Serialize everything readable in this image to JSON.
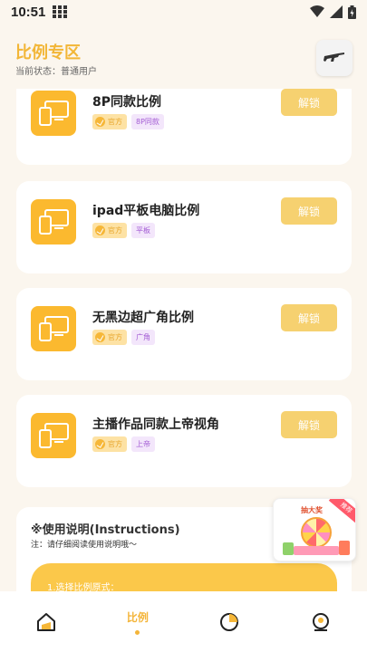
{
  "status_bar": {
    "time": "10:51"
  },
  "header": {
    "title": "比例专区",
    "status_text": "当前状态：普通用户"
  },
  "cards": [
    {
      "title": "8P同款比例",
      "official_tag": "官方",
      "category_tag": "8P同款",
      "unlock_label": "解锁"
    },
    {
      "title": "ipad平板电脑比例",
      "official_tag": "官方",
      "category_tag": "平板",
      "unlock_label": "解锁"
    },
    {
      "title": "无黑边超广角比例",
      "official_tag": "官方",
      "category_tag": "广角",
      "unlock_label": "解锁"
    },
    {
      "title": "主播作品同款上帝视角",
      "official_tag": "官方",
      "category_tag": "上帝",
      "unlock_label": "解锁"
    }
  ],
  "instructions": {
    "title": "※使用说明(Instructions)",
    "note": "注：请仔细阅读使用说明哦～",
    "step1": "1.选择比例原式："
  },
  "promo": {
    "title": "抽大奖",
    "badge": "推荐"
  },
  "bottom_nav": {
    "active_label": "比例",
    "items": [
      "home-icon",
      "ratio",
      "pie-chart-icon",
      "profile-icon"
    ]
  },
  "colors": {
    "accent": "#f4b53a",
    "card_icon_bg": "#fbb92f",
    "unlock_bg": "#f6d170",
    "page_bg": "#fbf6ee"
  }
}
